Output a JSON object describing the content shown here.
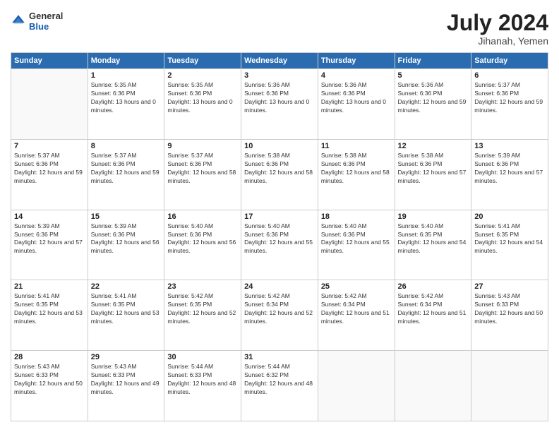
{
  "header": {
    "logo": {
      "general": "General",
      "blue": "Blue"
    },
    "title": "July 2024",
    "location": "Jihanah, Yemen"
  },
  "days_of_week": [
    "Sunday",
    "Monday",
    "Tuesday",
    "Wednesday",
    "Thursday",
    "Friday",
    "Saturday"
  ],
  "weeks": [
    [
      {
        "day": "",
        "sunrise": "",
        "sunset": "",
        "daylight": ""
      },
      {
        "day": "1",
        "sunrise": "Sunrise: 5:35 AM",
        "sunset": "Sunset: 6:36 PM",
        "daylight": "Daylight: 13 hours and 0 minutes."
      },
      {
        "day": "2",
        "sunrise": "Sunrise: 5:35 AM",
        "sunset": "Sunset: 6:36 PM",
        "daylight": "Daylight: 13 hours and 0 minutes."
      },
      {
        "day": "3",
        "sunrise": "Sunrise: 5:36 AM",
        "sunset": "Sunset: 6:36 PM",
        "daylight": "Daylight: 13 hours and 0 minutes."
      },
      {
        "day": "4",
        "sunrise": "Sunrise: 5:36 AM",
        "sunset": "Sunset: 6:36 PM",
        "daylight": "Daylight: 13 hours and 0 minutes."
      },
      {
        "day": "5",
        "sunrise": "Sunrise: 5:36 AM",
        "sunset": "Sunset: 6:36 PM",
        "daylight": "Daylight: 12 hours and 59 minutes."
      },
      {
        "day": "6",
        "sunrise": "Sunrise: 5:37 AM",
        "sunset": "Sunset: 6:36 PM",
        "daylight": "Daylight: 12 hours and 59 minutes."
      }
    ],
    [
      {
        "day": "7",
        "sunrise": "Sunrise: 5:37 AM",
        "sunset": "Sunset: 6:36 PM",
        "daylight": "Daylight: 12 hours and 59 minutes."
      },
      {
        "day": "8",
        "sunrise": "Sunrise: 5:37 AM",
        "sunset": "Sunset: 6:36 PM",
        "daylight": "Daylight: 12 hours and 59 minutes."
      },
      {
        "day": "9",
        "sunrise": "Sunrise: 5:37 AM",
        "sunset": "Sunset: 6:36 PM",
        "daylight": "Daylight: 12 hours and 58 minutes."
      },
      {
        "day": "10",
        "sunrise": "Sunrise: 5:38 AM",
        "sunset": "Sunset: 6:36 PM",
        "daylight": "Daylight: 12 hours and 58 minutes."
      },
      {
        "day": "11",
        "sunrise": "Sunrise: 5:38 AM",
        "sunset": "Sunset: 6:36 PM",
        "daylight": "Daylight: 12 hours and 58 minutes."
      },
      {
        "day": "12",
        "sunrise": "Sunrise: 5:38 AM",
        "sunset": "Sunset: 6:36 PM",
        "daylight": "Daylight: 12 hours and 57 minutes."
      },
      {
        "day": "13",
        "sunrise": "Sunrise: 5:39 AM",
        "sunset": "Sunset: 6:36 PM",
        "daylight": "Daylight: 12 hours and 57 minutes."
      }
    ],
    [
      {
        "day": "14",
        "sunrise": "Sunrise: 5:39 AM",
        "sunset": "Sunset: 6:36 PM",
        "daylight": "Daylight: 12 hours and 57 minutes."
      },
      {
        "day": "15",
        "sunrise": "Sunrise: 5:39 AM",
        "sunset": "Sunset: 6:36 PM",
        "daylight": "Daylight: 12 hours and 56 minutes."
      },
      {
        "day": "16",
        "sunrise": "Sunrise: 5:40 AM",
        "sunset": "Sunset: 6:36 PM",
        "daylight": "Daylight: 12 hours and 56 minutes."
      },
      {
        "day": "17",
        "sunrise": "Sunrise: 5:40 AM",
        "sunset": "Sunset: 6:36 PM",
        "daylight": "Daylight: 12 hours and 55 minutes."
      },
      {
        "day": "18",
        "sunrise": "Sunrise: 5:40 AM",
        "sunset": "Sunset: 6:36 PM",
        "daylight": "Daylight: 12 hours and 55 minutes."
      },
      {
        "day": "19",
        "sunrise": "Sunrise: 5:40 AM",
        "sunset": "Sunset: 6:35 PM",
        "daylight": "Daylight: 12 hours and 54 minutes."
      },
      {
        "day": "20",
        "sunrise": "Sunrise: 5:41 AM",
        "sunset": "Sunset: 6:35 PM",
        "daylight": "Daylight: 12 hours and 54 minutes."
      }
    ],
    [
      {
        "day": "21",
        "sunrise": "Sunrise: 5:41 AM",
        "sunset": "Sunset: 6:35 PM",
        "daylight": "Daylight: 12 hours and 53 minutes."
      },
      {
        "day": "22",
        "sunrise": "Sunrise: 5:41 AM",
        "sunset": "Sunset: 6:35 PM",
        "daylight": "Daylight: 12 hours and 53 minutes."
      },
      {
        "day": "23",
        "sunrise": "Sunrise: 5:42 AM",
        "sunset": "Sunset: 6:35 PM",
        "daylight": "Daylight: 12 hours and 52 minutes."
      },
      {
        "day": "24",
        "sunrise": "Sunrise: 5:42 AM",
        "sunset": "Sunset: 6:34 PM",
        "daylight": "Daylight: 12 hours and 52 minutes."
      },
      {
        "day": "25",
        "sunrise": "Sunrise: 5:42 AM",
        "sunset": "Sunset: 6:34 PM",
        "daylight": "Daylight: 12 hours and 51 minutes."
      },
      {
        "day": "26",
        "sunrise": "Sunrise: 5:42 AM",
        "sunset": "Sunset: 6:34 PM",
        "daylight": "Daylight: 12 hours and 51 minutes."
      },
      {
        "day": "27",
        "sunrise": "Sunrise: 5:43 AM",
        "sunset": "Sunset: 6:33 PM",
        "daylight": "Daylight: 12 hours and 50 minutes."
      }
    ],
    [
      {
        "day": "28",
        "sunrise": "Sunrise: 5:43 AM",
        "sunset": "Sunset: 6:33 PM",
        "daylight": "Daylight: 12 hours and 50 minutes."
      },
      {
        "day": "29",
        "sunrise": "Sunrise: 5:43 AM",
        "sunset": "Sunset: 6:33 PM",
        "daylight": "Daylight: 12 hours and 49 minutes."
      },
      {
        "day": "30",
        "sunrise": "Sunrise: 5:44 AM",
        "sunset": "Sunset: 6:33 PM",
        "daylight": "Daylight: 12 hours and 48 minutes."
      },
      {
        "day": "31",
        "sunrise": "Sunrise: 5:44 AM",
        "sunset": "Sunset: 6:32 PM",
        "daylight": "Daylight: 12 hours and 48 minutes."
      },
      {
        "day": "",
        "sunrise": "",
        "sunset": "",
        "daylight": ""
      },
      {
        "day": "",
        "sunrise": "",
        "sunset": "",
        "daylight": ""
      },
      {
        "day": "",
        "sunrise": "",
        "sunset": "",
        "daylight": ""
      }
    ]
  ]
}
